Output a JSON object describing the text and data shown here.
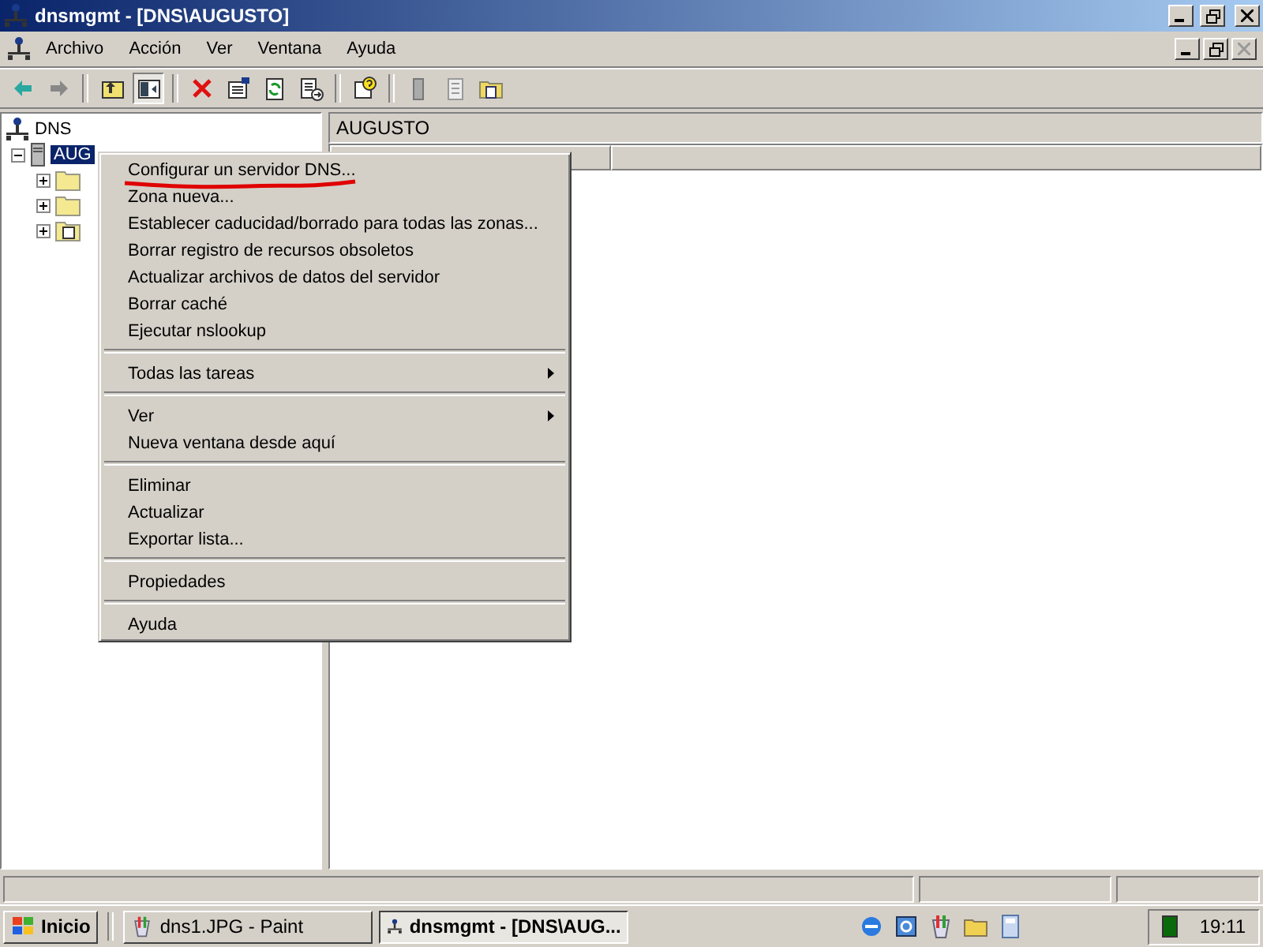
{
  "window": {
    "title": "dnsmgmt - [DNS\\AUGUSTO]"
  },
  "menubar": [
    "Archivo",
    "Acción",
    "Ver",
    "Ventana",
    "Ayuda"
  ],
  "toolbar": [
    {
      "kind": "back"
    },
    {
      "kind": "forward"
    },
    {
      "kind": "sep"
    },
    {
      "kind": "up"
    },
    {
      "kind": "tree"
    },
    {
      "kind": "sep"
    },
    {
      "kind": "delete"
    },
    {
      "kind": "properties"
    },
    {
      "kind": "refresh"
    },
    {
      "kind": "export"
    },
    {
      "kind": "sep"
    },
    {
      "kind": "help"
    },
    {
      "kind": "sep"
    },
    {
      "kind": "server"
    },
    {
      "kind": "notes"
    },
    {
      "kind": "folder"
    }
  ],
  "tree": {
    "label": "DNS",
    "children": [
      {
        "label": "AUG",
        "kind": "server",
        "expanded": true,
        "selected": true,
        "children": [
          {
            "kind": "folder"
          },
          {
            "kind": "folder"
          },
          {
            "kind": "log"
          }
        ]
      }
    ]
  },
  "right_pane": {
    "title": "AUGUSTO"
  },
  "context_menu": [
    {
      "kind": "item",
      "label": "Configurar un servidor DNS...",
      "annotated": true
    },
    {
      "kind": "item",
      "label": "Zona nueva..."
    },
    {
      "kind": "item",
      "label": "Establecer caducidad/borrado para todas las zonas..."
    },
    {
      "kind": "item",
      "label": "Borrar registro de recursos obsoletos"
    },
    {
      "kind": "item",
      "label": "Actualizar archivos de datos del servidor"
    },
    {
      "kind": "item",
      "label": "Borrar caché"
    },
    {
      "kind": "item",
      "label": "Ejecutar nslookup"
    },
    {
      "kind": "sep"
    },
    {
      "kind": "submenu",
      "label": "Todas las tareas"
    },
    {
      "kind": "sep"
    },
    {
      "kind": "submenu",
      "label": "Ver"
    },
    {
      "kind": "item",
      "label": "Nueva ventana desde aquí"
    },
    {
      "kind": "sep"
    },
    {
      "kind": "item",
      "label": "Eliminar"
    },
    {
      "kind": "item",
      "label": "Actualizar"
    },
    {
      "kind": "item",
      "label": "Exportar lista..."
    },
    {
      "kind": "sep"
    },
    {
      "kind": "item",
      "label": "Propiedades"
    },
    {
      "kind": "sep"
    },
    {
      "kind": "item",
      "label": "Ayuda"
    }
  ],
  "taskbar": {
    "start": "Inicio",
    "tasks": [
      {
        "label": "dns1.JPG - Paint",
        "kind": "paint",
        "selected": false
      },
      {
        "label": "dnsmgmt - [DNS\\AUG...",
        "kind": "mmc",
        "selected": true
      }
    ],
    "quick_launch": [
      {
        "kind": "ie"
      },
      {
        "kind": "outlook"
      },
      {
        "kind": "paint"
      },
      {
        "kind": "folder"
      },
      {
        "kind": "calc"
      }
    ],
    "clock": "19:11"
  }
}
